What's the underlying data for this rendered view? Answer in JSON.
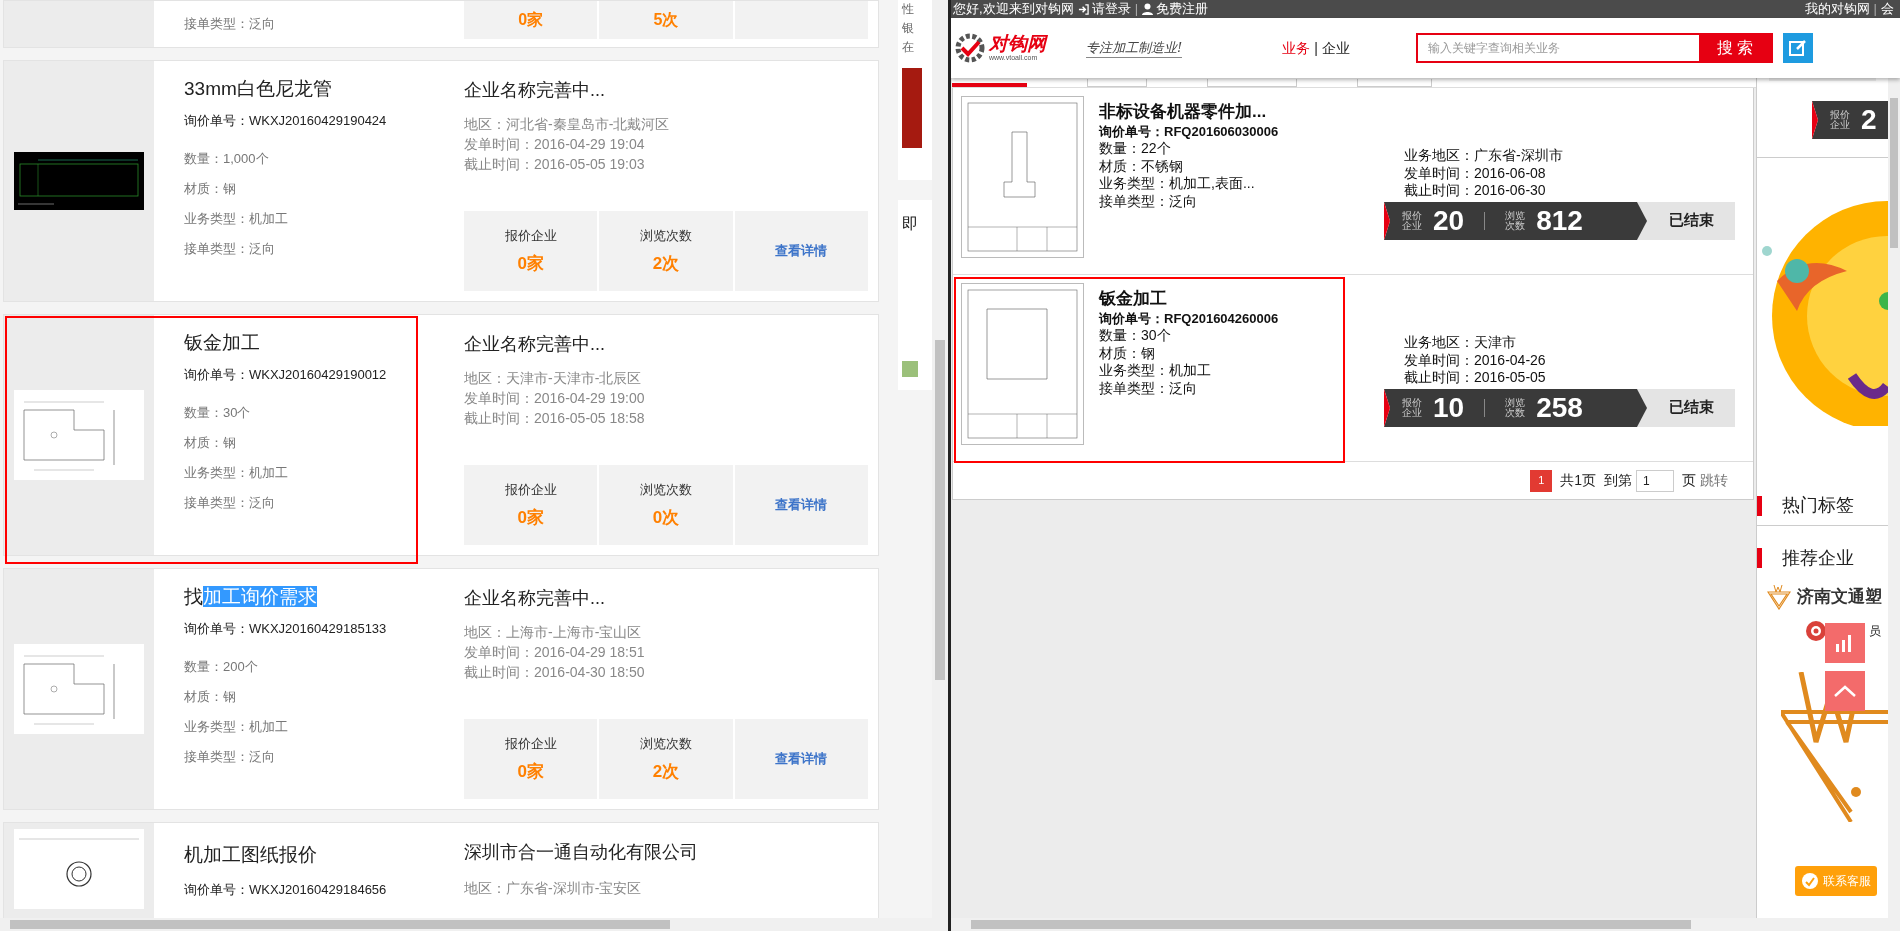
{
  "left_window": {
    "partial_card": {
      "order_type": "接单类型：泛向",
      "stats": [
        {
          "value": "0家"
        },
        {
          "value": "5次"
        }
      ]
    },
    "cards": [
      {
        "title_segments": [
          {
            "text": "33mm白色尼龙管",
            "selected": false
          }
        ],
        "order_no": "询价单号：WKXJ20160429190424",
        "details": [
          "数量：1,000个",
          "材质：钢",
          "业务类型：机加工",
          "接单类型：泛向"
        ],
        "company": "企业名称完善中...",
        "region_lines": [
          "地区：河北省-秦皇岛市-北戴河区",
          "发单时间：2016-04-29 19:04",
          "截止时间：2016-05-05 19:03"
        ],
        "stats": [
          {
            "label": "报价企业",
            "value": "0家"
          },
          {
            "label": "浏览次数",
            "value": "2次"
          }
        ],
        "link": "查看详情",
        "kind": "dark",
        "highlighted": false
      },
      {
        "title_segments": [
          {
            "text": "钣金加工",
            "selected": false
          }
        ],
        "order_no": "询价单号：WKXJ20160429190012",
        "details": [
          "数量：30个",
          "材质：钢",
          "业务类型：机加工",
          "接单类型：泛向"
        ],
        "company": "企业名称完善中...",
        "region_lines": [
          "地区：天津市-天津市-北辰区",
          "发单时间：2016-04-29 19:00",
          "截止时间：2016-05-05 18:58"
        ],
        "stats": [
          {
            "label": "报价企业",
            "value": "0家"
          },
          {
            "label": "浏览次数",
            "value": "0次"
          }
        ],
        "link": "查看详情",
        "kind": "light",
        "highlighted": true
      },
      {
        "title_segments": [
          {
            "text": "找",
            "selected": false
          },
          {
            "text": "加工询价需求",
            "selected": true
          }
        ],
        "order_no": "询价单号：WKXJ20160429185133",
        "details": [
          "数量：200个",
          "材质：钢",
          "业务类型：机加工",
          "接单类型：泛向"
        ],
        "company": "企业名称完善中...",
        "region_lines": [
          "地区：上海市-上海市-宝山区",
          "发单时间：2016-04-29 18:51",
          "截止时间：2016-04-30 18:50"
        ],
        "stats": [
          {
            "label": "报价企业",
            "value": "0家"
          },
          {
            "label": "浏览次数",
            "value": "2次"
          }
        ],
        "link": "查看详情",
        "kind": "light",
        "highlighted": false
      }
    ],
    "last_card": {
      "title": "机加工图纸报价",
      "order_no": "询价单号：WKXJ20160429184656",
      "company": "深圳市合一通自动化有限公司",
      "region": "地区：广东省-深圳市-宝安区"
    },
    "side_fragment": {
      "text": "性银在",
      "heading": "即"
    }
  },
  "right_window": {
    "top_bar": {
      "greeting": "您好,欢迎来到对钩网",
      "links": [
        {
          "text": "请登录",
          "kind": "login"
        },
        {
          "text": "免费注册",
          "kind": "register"
        }
      ],
      "separator": "|",
      "right_links": [
        "我的对钩网",
        "会"
      ]
    },
    "header": {
      "logo": {
        "name": "对钩网",
        "url": "www.vtoall.com"
      },
      "slogan": "专注加工制造业!",
      "nav": [
        {
          "label": "业务",
          "selected": true
        },
        {
          "label": "企业",
          "selected": false
        }
      ],
      "nav_separator": "|",
      "search": {
        "placeholder": "输入关键字查询相关业务",
        "button": "搜索"
      }
    },
    "listings": [
      {
        "title": "非标设备机器零件加...",
        "order_no": "询价单号：RFQ201606030006",
        "details": [
          "数量：22个",
          "材质：不锈钢",
          "业务类型：机加工,表面...",
          "接单类型：泛向"
        ],
        "region_lines": [
          "业务地区：广东省-深圳市",
          "发单时间：2016-06-08",
          "截止时间：2016-06-30"
        ],
        "quote_label": "报价企业",
        "quote_count": "20",
        "view_label": "浏览次数",
        "view_count": "812",
        "status": "已结束",
        "highlighted": false
      },
      {
        "title": "钣金加工",
        "order_no": "询价单号：RFQ201604260006",
        "details": [
          "数量：30个",
          "材质：钢",
          "业务类型：机加工",
          "接单类型：泛向"
        ],
        "region_lines": [
          "业务地区：天津市",
          "发单时间：2016-04-26",
          "截止时间：2016-05-05"
        ],
        "quote_label": "报价企业",
        "quote_count": "10",
        "view_label": "浏览次数",
        "view_count": "258",
        "status": "已结束",
        "highlighted": true
      }
    ],
    "pagination": {
      "pages": [
        {
          "label": "1",
          "selected": true
        }
      ],
      "total": "共1页",
      "goto": "到第",
      "page_input": "1",
      "unit": "页",
      "jump": "跳转"
    },
    "sidebar": {
      "partial_banner": {
        "label": "报价企业",
        "value": "2"
      },
      "hot_tags_title": "热门标签",
      "recommended_title": "推荐企业",
      "company": "济南文通塑",
      "member": "员",
      "contact_button": "联系客服"
    }
  }
}
